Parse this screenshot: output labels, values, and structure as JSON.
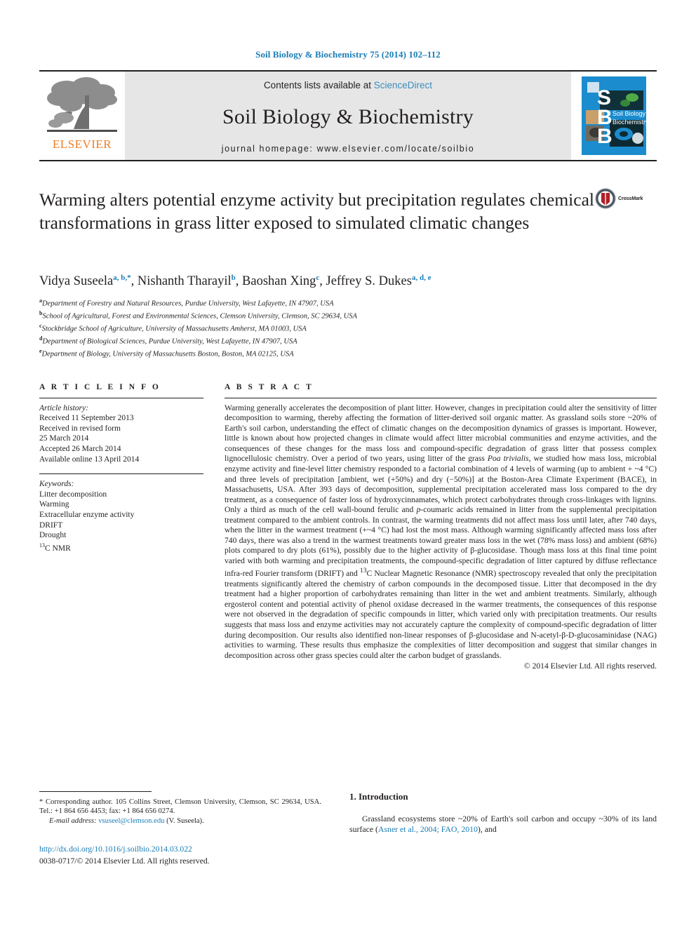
{
  "running_head": "Soil Biology & Biochemistry 75 (2014) 102–112",
  "masthead": {
    "contents_prefix": "Contents lists available at ",
    "sciencedirect": "ScienceDirect",
    "journal_title": "Soil Biology & Biochemistry",
    "homepage": "journal homepage: www.elsevier.com/locate/soilbio",
    "publisher_wordmark": "ELSEVIER",
    "cover_letters": [
      "S",
      "B",
      "B"
    ],
    "cover_title_line1": "Soil Biology &",
    "cover_title_line2": "Biochemistry"
  },
  "article": {
    "title": "Warming alters potential enzyme activity but precipitation regulates chemical transformations in grass litter exposed to simulated climatic changes",
    "crossmark_label": "CrossMark",
    "authors": [
      {
        "name": "Vidya Suseela",
        "marks": "a, b,",
        "star": "*"
      },
      {
        "name": "Nishanth Tharayil",
        "marks": "b",
        "star": ""
      },
      {
        "name": "Baoshan Xing",
        "marks": "c",
        "star": ""
      },
      {
        "name": "Jeffrey S. Dukes",
        "marks": "a, d, e",
        "star": ""
      }
    ],
    "affiliations": [
      {
        "mark": "a",
        "text": "Department of Forestry and Natural Resources, Purdue University, West Lafayette, IN 47907, USA"
      },
      {
        "mark": "b",
        "text": "School of Agricultural, Forest and Environmental Sciences, Clemson University, Clemson, SC 29634, USA"
      },
      {
        "mark": "c",
        "text": "Stockbridge School of Agriculture, University of Massachusetts Amherst, MA 01003, USA"
      },
      {
        "mark": "d",
        "text": "Department of Biological Sciences, Purdue University, West Lafayette, IN 47907, USA"
      },
      {
        "mark": "e",
        "text": "Department of Biology, University of Massachusetts Boston, Boston, MA 02125, USA"
      }
    ]
  },
  "article_info": {
    "heading": "A R T I C L E  I N F O",
    "history_label": "Article history:",
    "history": [
      "Received 11 September 2013",
      "Received in revised form",
      "25 March 2014",
      "Accepted 26 March 2014",
      "Available online 13 April 2014"
    ],
    "keywords_label": "Keywords:",
    "keywords": [
      "Litter decomposition",
      "Warming",
      "Extracellular enzyme activity",
      "DRIFT",
      "Drought"
    ],
    "keyword_nmr_sup": "13",
    "keyword_nmr_rest": "C NMR"
  },
  "abstract": {
    "heading": "A B S T R A C T",
    "paragraph_1": "Warming generally accelerates the decomposition of plant litter. However, changes in precipitation could alter the sensitivity of litter decomposition to warming, thereby affecting the formation of litter-derived soil organic matter. As grassland soils store ~20% of Earth's soil carbon, understanding the effect of climatic changes on the decomposition dynamics of grasses is important. However, little is known about how projected changes in climate would affect litter microbial communities and enzyme activities, and the consequences of these changes for the mass loss and compound-specific degradation of grass litter that possess complex lignocellulosic chemistry. Over a period of two years, using litter of the grass ",
    "species_italic": "Poa trivialis",
    "paragraph_2": ", we studied how mass loss, microbial enzyme activity and fine-level litter chemistry responded to a factorial combination of 4 levels of warming (up to ambient + ~4 °C) and three levels of precipitation [ambient, wet (+50%) and dry (−50%)] at the Boston-Area Climate Experiment (BACE), in Massachusetts, USA. After 393 days of decomposition, supplemental precipitation accelerated mass loss compared to the dry treatment, as a consequence of faster loss of hydroxycinnamates, which protect carbohydrates through cross-linkages with lignins. Only a third as much of the cell wall-bound ferulic and ",
    "pcoumaric_italic": "p",
    "paragraph_3": "-coumaric acids remained in litter from the supplemental precipitation treatment compared to the ambient controls. In contrast, the warming treatments did not affect mass loss until later, after 740 days, when the litter in the warmest treatment (+~4 °C) had lost the most mass. Although warming significantly affected mass loss after 740 days, there was also a trend in the warmest treatments toward greater mass loss in the wet (78% mass loss) and ambient (68%) plots compared to dry plots (61%), possibly due to the higher activity of β-glucosidase. Though mass loss at this final time point varied with both warming and precipitation treatments, the compound-specific degradation of litter captured by diffuse reflectance infra-red Fourier transform (DRIFT) and ",
    "nmr_sup": "13",
    "paragraph_4": "C Nuclear Magnetic Resonance (NMR) spectroscopy revealed that only the precipitation treatments significantly altered the chemistry of carbon compounds in the decomposed tissue. Litter that decomposed in the dry treatment had a higher proportion of carbohydrates remaining than litter in the wet and ambient treatments. Similarly, although ergosterol content and potential activity of phenol oxidase decreased in the warmer treatments, the consequences of this response were not observed in the degradation of specific compounds in litter, which varied only with precipitation treatments. Our results suggests that mass loss and enzyme activities may not accurately capture the complexity of compound-specific degradation of litter during decomposition. Our results also identified non-linear responses of β-glucosidase and N-acetyl-β-D-glucosaminidase (NAG) activities to warming. These results thus emphasize the complexities of litter decomposition and suggest that similar changes in decomposition across other grass species could alter the carbon budget of grasslands.",
    "copyright": "© 2014 Elsevier Ltd. All rights reserved."
  },
  "footer": {
    "corresponding_star": "*",
    "corresponding_text": " Corresponding author. 105 Collins Street, Clemson University, Clemson, SC 29634, USA. Tel.: +1 864 656 4453; fax: +1 864 656 0274.",
    "email_label": "E-mail address:",
    "email": "vsuseel@clemson.edu",
    "email_suffix": " (V. Suseela).",
    "doi_url": "http://dx.doi.org/10.1016/j.soilbio.2014.03.022",
    "issn_line": "0038-0717/© 2014 Elsevier Ltd. All rights reserved."
  },
  "introduction": {
    "heading": "1. Introduction",
    "text_before_cite": "Grassland ecosystems store ~20% of Earth's soil carbon and occupy ~30% of its land surface (",
    "citation": "Asner et al., 2004; FAO, 2010",
    "text_after_cite": "), and"
  },
  "colors": {
    "link_blue": "#1a7db6",
    "sciencedirect_blue": "#3c8dbc",
    "elsevier_orange": "#ef7d23",
    "cover_blue": "#1b8ccd",
    "text": "#231f20"
  }
}
